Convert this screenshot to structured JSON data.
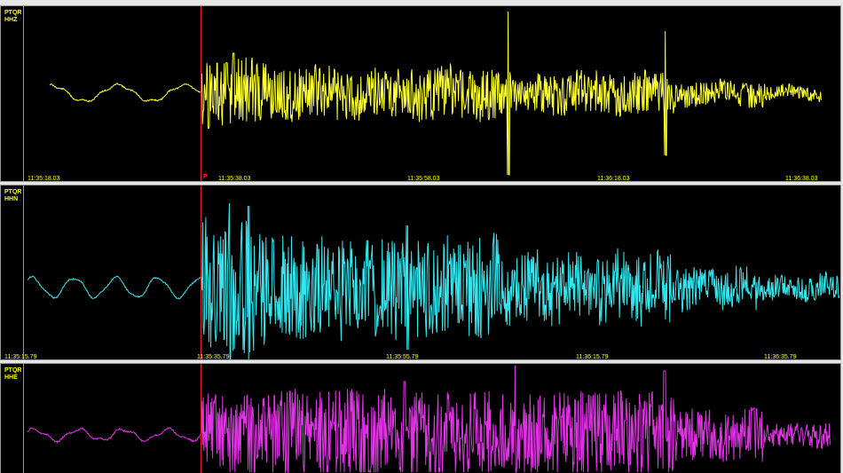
{
  "panels": [
    {
      "station": "PTQR",
      "channel": "HHZ",
      "trace_color": "#ffff33",
      "ticks": [
        "11:35:18.03",
        "11:35:38.03",
        "11:35:58.03",
        "11:36:18.03",
        "11:36:38.03"
      ],
      "p_label": "P"
    },
    {
      "station": "PTQR",
      "channel": "HHN",
      "trace_color": "#33e6f0",
      "ticks": [
        "11:35:15.79",
        "11:35:35.79",
        "11:35:55.79",
        "11:36:15.79",
        "11:36:35.79"
      ],
      "p_label": ""
    },
    {
      "station": "PTQR",
      "channel": "HHE",
      "trace_color": "#e033e6",
      "ticks": [],
      "p_label": ""
    }
  ],
  "colors": {
    "background": "#000000",
    "label_text": "#ffff00",
    "pick_line": "#e02020"
  }
}
